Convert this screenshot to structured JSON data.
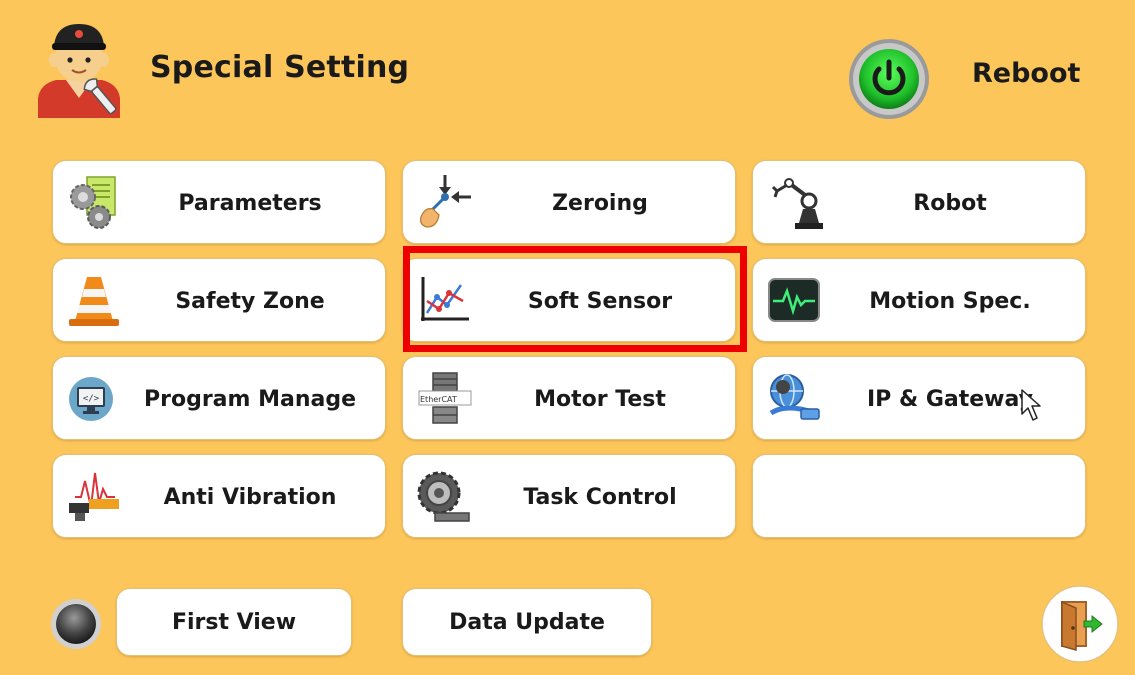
{
  "header": {
    "title": "Special Setting",
    "reboot_label": "Reboot",
    "avatar_icon": "mechanic-icon",
    "reboot_icon": "power-icon"
  },
  "tiles": [
    {
      "label": "Parameters",
      "icon": "parameters-gears-icon"
    },
    {
      "label": "Zeroing",
      "icon": "zeroing-hand-icon"
    },
    {
      "label": "Robot",
      "icon": "robot-arm-icon"
    },
    {
      "label": "Safety Zone",
      "icon": "traffic-cone-icon"
    },
    {
      "label": "Soft Sensor",
      "icon": "line-chart-icon"
    },
    {
      "label": "Motion Spec.",
      "icon": "activity-monitor-icon"
    },
    {
      "label": "Program Manage",
      "icon": "code-monitor-icon"
    },
    {
      "label": "Motor Test",
      "icon": "ethercat-motor-icon"
    },
    {
      "label": "IP & Gateway",
      "icon": "network-globe-icon"
    },
    {
      "label": "Anti Vibration",
      "icon": "vibration-icon"
    },
    {
      "label": "Task Control",
      "icon": "gear-belt-icon"
    },
    {
      "label": "",
      "icon": ""
    }
  ],
  "ethercat_text": "EtherCAT",
  "highlighted_tile": "Soft Sensor",
  "footer": {
    "first_view_label": "First View",
    "data_update_label": "Data Update",
    "status_icon": "status-led-icon",
    "exit_icon": "exit-door-icon"
  },
  "colors": {
    "background": "#fdc65a",
    "tile": "#ffffff",
    "highlight": "#ee0000",
    "power_green": "#2ecc40"
  }
}
